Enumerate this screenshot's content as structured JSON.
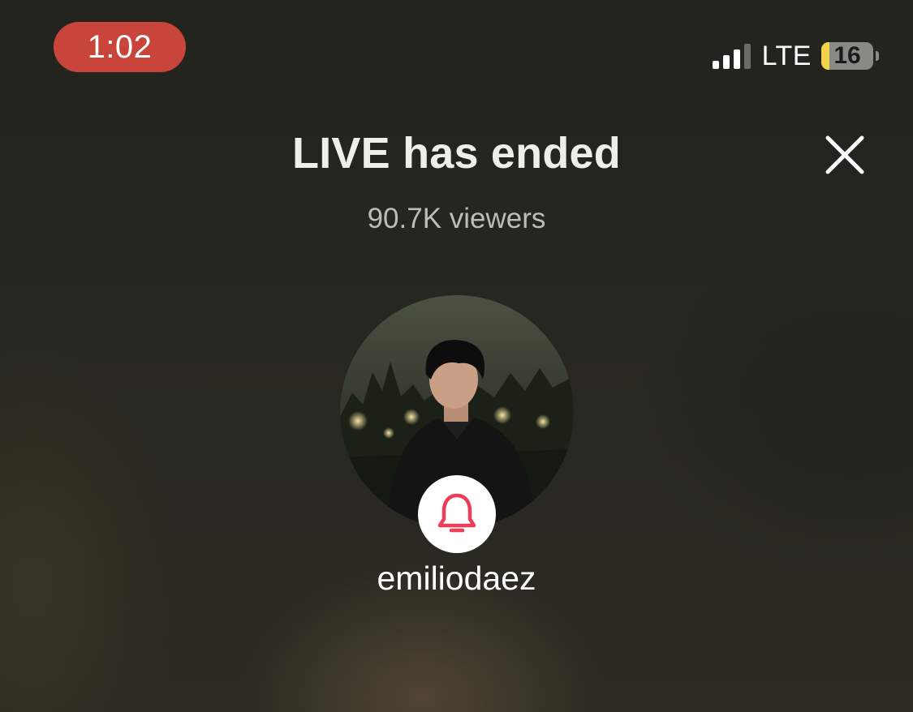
{
  "status_bar": {
    "time": "1:02",
    "network": "LTE",
    "battery_level": "16",
    "signal_bars_active": 3,
    "signal_bars_total": 4,
    "recording_pill_color": "#c9453c",
    "battery_fill_color": "#f3d34a"
  },
  "live_ended": {
    "title": "LIVE has ended",
    "viewers": "90.7K viewers",
    "close_icon": "close-icon"
  },
  "creator": {
    "username": "emiliodaez",
    "avatar": "profile-photo",
    "notify_icon": "bell-icon",
    "notify_icon_color": "#ee3d56"
  }
}
